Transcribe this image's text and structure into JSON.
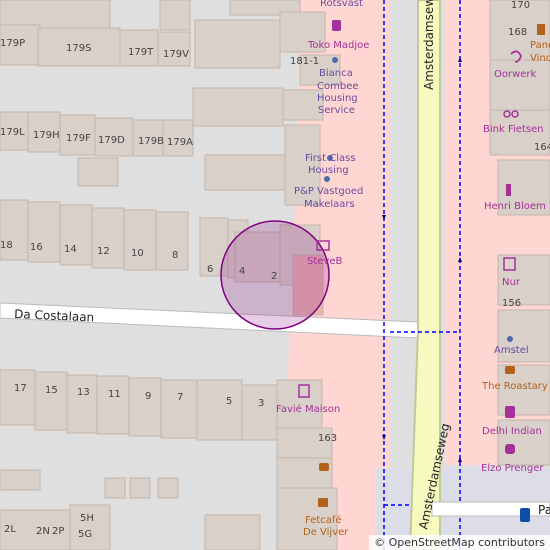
{
  "street_names": {
    "amsterdamseweg_top": "Amsterdamseweg",
    "amsterdamseweg_bottom": "Amsterdamseweg",
    "da_costalaan": "Da Costalaan",
    "pa_partial": "Pa"
  },
  "house_numbers": {
    "n179p": "179P",
    "n179s": "179S",
    "n179t": "179T",
    "n179v": "179V",
    "n181_1": "181-1",
    "n179l": "179L",
    "n179h": "179H",
    "n179f": "179F",
    "n179d": "179D",
    "n179b": "179B",
    "n179a": "179A",
    "n18": "18",
    "n16": "16",
    "n14": "14",
    "n12": "12",
    "n10": "10",
    "n8": "8",
    "n6": "6",
    "n4": "4",
    "n2": "2",
    "n170": "170",
    "n168": "168",
    "n164": "164",
    "n156": "156",
    "n163": "163",
    "n17": "17",
    "n15": "15",
    "n13": "13",
    "n11": "11",
    "n9": "9",
    "n7": "7",
    "n5": "5",
    "n3": "3",
    "n5h": "5H",
    "n2l": "2L",
    "n2n": "2N",
    "n2p": "2P",
    "n5g": "5G"
  },
  "pois": {
    "rotsvast": "Rotsvast",
    "toko_madjoe": "Toko Madjoe",
    "bianca_1": "Bianca",
    "bianca_2": "Combee",
    "bianca_3": "Housing",
    "bianca_4": "Service",
    "first_class_1": "First Class",
    "first_class_2": "Housing",
    "pp_1": "P&P Vastgoed",
    "pp_2": "Makelaars",
    "steveb": "SteveB",
    "favie_maison": "Favié Maison",
    "fetcafe_1": "Fetcafé",
    "fetcafe_2": "De Vijver",
    "pane_1": "Pane",
    "pane_2": "Vino",
    "oorwerk": "Oorwerk",
    "bink": "Bink Fietsen",
    "henri": "Henri Bloem",
    "nur": "Nur",
    "amstel": "Amstel",
    "roastary": "The Roastary",
    "delhi": "Delhi Indian",
    "elzo": "Elzo Prenger"
  },
  "colors": {
    "background": "#e0dfdf",
    "building": "#d9d0c9",
    "building_stroke": "#c4b6ab",
    "retail": "#ffd6d1",
    "trunk_road": "#f7fabf",
    "road_casing": "#c3c79a",
    "footway": "#ffffff",
    "cycleway": "#0000ff",
    "poi_purple": "#6b4ba1",
    "poi_shop": "#a6309a",
    "poi_food": "#b3621d",
    "highlight_circle": "#800080"
  },
  "attribution": "© OpenStreetMap contributors"
}
